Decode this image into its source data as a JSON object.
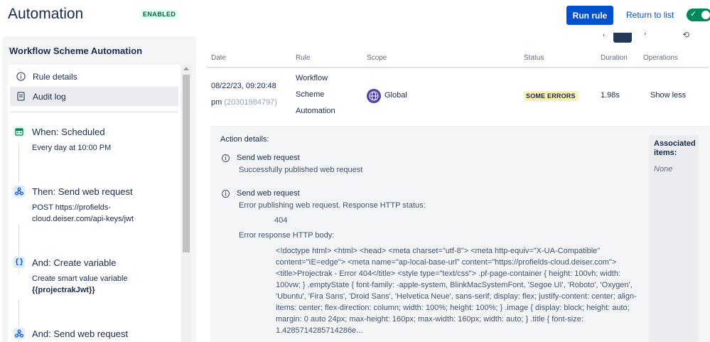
{
  "header": {
    "title": "Automation",
    "enabled_badge": "ENABLED",
    "run_rule": "Run rule",
    "return_to_list": "Return to list",
    "toggle_state": "on"
  },
  "sidebar": {
    "title": "Workflow Scheme Automation",
    "menu": [
      {
        "label": "Rule details",
        "icon": "info-icon"
      },
      {
        "label": "Audit log",
        "icon": "document-icon",
        "active": true
      }
    ],
    "steps": [
      {
        "label": "When: Scheduled",
        "icon": "calendar-icon",
        "lines": [
          "Every day at 10:00 PM"
        ]
      },
      {
        "label": "Then: Send web request",
        "icon": "webhook-icon",
        "lines": [
          "POST https://profields-",
          "cloud.deiser.com/api-keys/jwt"
        ]
      },
      {
        "label": "And: Create variable",
        "icon": "braces-icon",
        "lines": [
          "Create smart value variable"
        ],
        "bold": "{{projectrakJwt}}"
      },
      {
        "label": "And: Send web request",
        "icon": "webhook-icon",
        "lines": []
      }
    ]
  },
  "table": {
    "columns": [
      "Date",
      "Rule",
      "Scope",
      "Status",
      "Duration",
      "Operations"
    ],
    "row": {
      "date_line1": "08/22/23, 09:20:48",
      "date_line2": "pm",
      "date_id": "(20301984797)",
      "rule_lines": [
        "Workflow",
        "Scheme",
        "Automation"
      ],
      "scope": "Global",
      "status": "SOME ERRORS",
      "duration": "1.98s",
      "operation": "Show less"
    }
  },
  "details": {
    "title": "Action details:",
    "associated_title": "Associated items:",
    "associated_value": "None",
    "entries": [
      {
        "title": "Send web request",
        "lines": [
          "Successfully published web request"
        ]
      },
      {
        "title": "Send web request",
        "lines": [
          "Error publishing web request. Response HTTP status:"
        ],
        "status_code": "404",
        "body_label": "Error response HTTP body:"
      }
    ],
    "response_body": "<!doctype html> <html> <head> <meta charset=\"utf-8\"> <meta http-equiv=\"X-UA-Compatible\" content=\"IE=edge\"> <meta name=\"ap-local-base-url\" content=\"https://profields-cloud.deiser.com\"> <title>Projectrak - Error 404</title> <style type=\"text/css\"> .pf-page-container { height: 100vh; width: 100vw; } .emptyState { font-family: -apple-system, BlinkMacSystemFont, 'Segoe UI', 'Roboto', 'Oxygen', 'Ubuntu', 'Fira Sans', 'Droid Sans', 'Helvetica Neue', sans-serif; display: flex; justify-content: center; align-items: center; flex-direction: column; width: 100%; height: 100%; } .image { display: block; height: auto; margin: 0 auto 24px; max-height: 160px; max-width: 160px; width: auto; } .title { font-size: 1.4285714285714286e..."
  },
  "colors": {
    "primary": "#0052cc",
    "success": "#00875a",
    "warning_bg": "#fff0b3",
    "scope": "#5243aa"
  }
}
